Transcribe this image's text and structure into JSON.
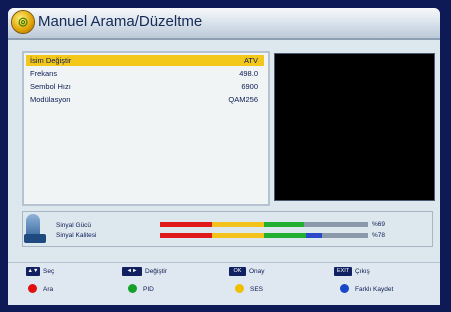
{
  "header": {
    "title": "Manuel Arama/Düzeltme",
    "logo_icon": "globe-icon"
  },
  "fields": [
    {
      "label": "İsim Değiştir",
      "value": "ATV",
      "selected": true
    },
    {
      "label": "Frekans",
      "value": "498.0",
      "selected": false
    },
    {
      "label": "Sembol Hızı",
      "value": "6900",
      "selected": false
    },
    {
      "label": "Modülasyon",
      "value": "QAM256",
      "selected": false
    }
  ],
  "signal": {
    "strength_label": "Sinyal Gücü",
    "strength_value": "%69",
    "strength_level": 0.69,
    "quality_label": "Sinyal Kalitesi",
    "quality_value": "%78",
    "quality_level": 0.78
  },
  "footer": {
    "select": {
      "key": "▲▼",
      "label": "Seç"
    },
    "change": {
      "key": "◄►",
      "label": "Değiştir"
    },
    "ok": {
      "key": "OK",
      "label": "Onay"
    },
    "exit": {
      "key": "EXIT",
      "label": "Çıkış"
    },
    "red": {
      "label": "Ara",
      "color": "#e01010"
    },
    "green": {
      "label": "PID",
      "color": "#16a02a"
    },
    "yellow": {
      "label": "SES",
      "color": "#f0c000"
    },
    "blue": {
      "label": "Farklı Kaydet",
      "color": "#1848c8"
    }
  },
  "colors": {
    "selection": "#f3c81a",
    "bar_red": "#e01a1a",
    "bar_yellow": "#f4c21c",
    "bar_green": "#22b030",
    "bar_blue": "#2a48c8"
  }
}
